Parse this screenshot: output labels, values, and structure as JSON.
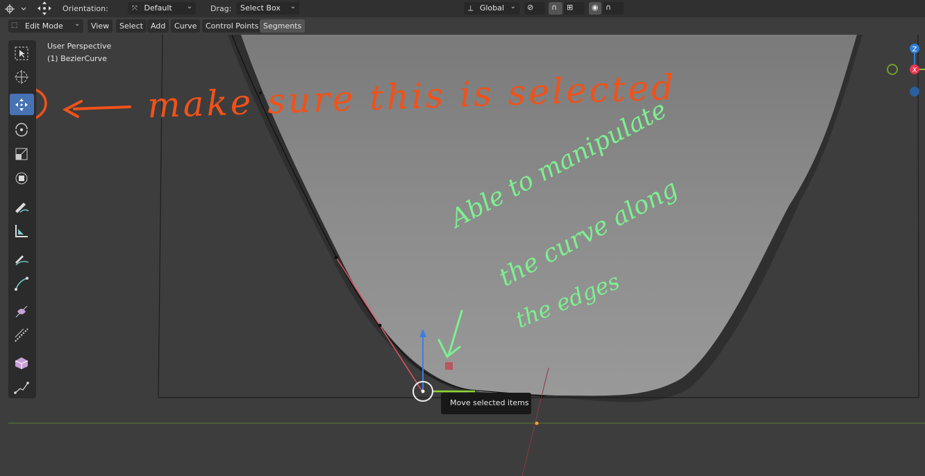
{
  "header": {
    "orientation_label": "Orientation:",
    "orientation_value": "Default",
    "drag_label": "Drag:",
    "drag_value": "Select Box",
    "transform_space": "Global"
  },
  "mode_bar": {
    "mode": "Edit Mode",
    "menus": [
      "View",
      "Select",
      "Add",
      "Curve",
      "Control Points",
      "Segments"
    ]
  },
  "viewport": {
    "perspective_label": "User Perspective",
    "object_label": "(1) BezierCurve"
  },
  "toolbar": {
    "tools": [
      "select-box",
      "cursor",
      "move",
      "rotate",
      "scale",
      "transform",
      "annotate",
      "measure",
      "draw",
      "pen",
      "tilt",
      "radius",
      "extrude",
      "randomize"
    ],
    "active_tool": "move"
  },
  "tooltip": {
    "text": "Move selected items"
  },
  "annotations": {
    "orange_note": "make sure this is selected",
    "green_note_line1": "Able to manipulate",
    "green_note_line2": "the curve along",
    "green_note_line3": "the edges"
  },
  "colors": {
    "active_tool": "#4772b3",
    "orange_annotation": "#f0521a",
    "green_annotation": "#7cf08f",
    "axis_z": "#2f7fd6",
    "axis_x": "#e8364f",
    "axis_y": "#6fa02a"
  }
}
